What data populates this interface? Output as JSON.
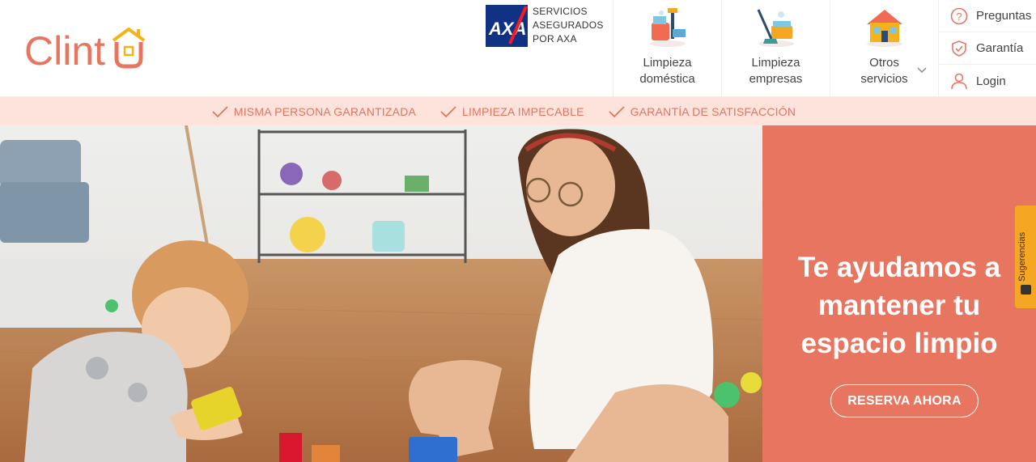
{
  "brand": {
    "name": "Clintu",
    "color": "#e8755f"
  },
  "insurance": {
    "logo_text": "AXA",
    "line1": "SERVICIOS",
    "line2": "ASEGURADOS",
    "line3": "POR AXA"
  },
  "nav": {
    "items": [
      {
        "line1": "Limpieza",
        "line2": "doméstica",
        "icon": "cleaning-bucket-icon"
      },
      {
        "line1": "Limpieza",
        "line2": "empresas",
        "icon": "mop-bucket-icon"
      },
      {
        "line1": "Otros",
        "line2": "servicios",
        "icon": "house-icon"
      }
    ]
  },
  "side_links": [
    {
      "label": "Preguntas",
      "icon": "question-icon"
    },
    {
      "label": "Garantía",
      "icon": "shield-check-icon"
    },
    {
      "label": "Login",
      "icon": "user-icon"
    }
  ],
  "guarantees": [
    "MISMA PERSONA GARANTIZADA",
    "LIMPIEZA IMPECABLE",
    "GARANTÍA DE SATISFACCIÓN"
  ],
  "hero": {
    "title_line1": "Te ayudamos a",
    "title_line2": "mantener tu",
    "title_line3": "espacio limpio",
    "cta": "RESERVA AHORA"
  },
  "feedback_tab": {
    "label": "Sugerencias",
    "color": "#f5a623"
  },
  "colors": {
    "accent": "#e8755f",
    "guarantee_bg": "#fde3dc",
    "guarantee_text": "#e4745f"
  }
}
